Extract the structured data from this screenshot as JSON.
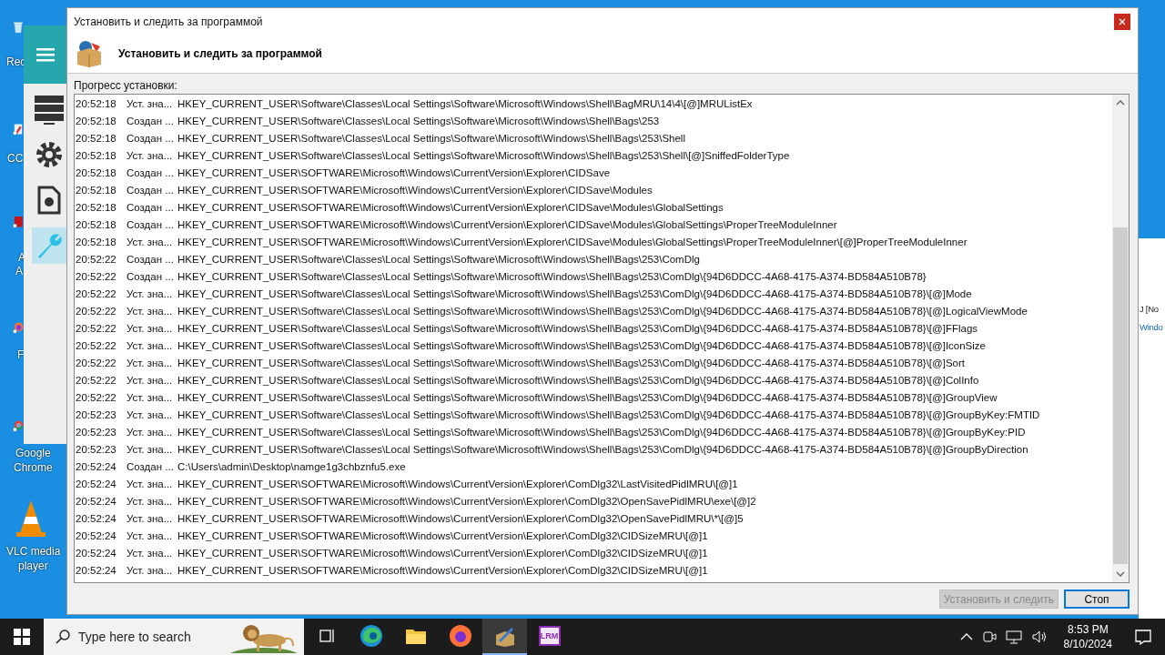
{
  "desktop": {
    "icons": [
      {
        "kind": "recycle",
        "lines": [
          "Rec"
        ]
      },
      {
        "kind": "cc",
        "lines": [
          "CC"
        ]
      },
      {
        "kind": "acrobat",
        "lines": [
          "A",
          "A"
        ]
      },
      {
        "kind": "firefox",
        "lines": [
          "F"
        ]
      },
      {
        "kind": "chrome",
        "lines": [
          "Google",
          "Chrome"
        ]
      },
      {
        "kind": "vlc",
        "lines": [
          "VLC media",
          "player"
        ]
      }
    ],
    "side_window": {
      "lines": [
        "J [No",
        "Windo"
      ]
    }
  },
  "background_app": {
    "sidebar": [
      {
        "kind": "server",
        "selected": false
      },
      {
        "kind": "gear",
        "selected": false
      },
      {
        "kind": "document",
        "selected": false
      },
      {
        "kind": "wrench",
        "selected": true
      }
    ]
  },
  "window": {
    "title": "Установить и следить за программой",
    "heading": "Установить и следить за программой",
    "progress_label": "Прогресс установки:",
    "log": [
      {
        "time": "20:52:18",
        "action": "Уст. зна...",
        "path": "HKEY_CURRENT_USER\\Software\\Classes\\Local Settings\\Software\\Microsoft\\Windows\\Shell\\BagMRU\\14\\4\\[@]MRUListEx"
      },
      {
        "time": "20:52:18",
        "action": "Создан ...",
        "path": "HKEY_CURRENT_USER\\Software\\Classes\\Local Settings\\Software\\Microsoft\\Windows\\Shell\\Bags\\253"
      },
      {
        "time": "20:52:18",
        "action": "Создан ...",
        "path": "HKEY_CURRENT_USER\\Software\\Classes\\Local Settings\\Software\\Microsoft\\Windows\\Shell\\Bags\\253\\Shell"
      },
      {
        "time": "20:52:18",
        "action": "Уст. зна...",
        "path": "HKEY_CURRENT_USER\\Software\\Classes\\Local Settings\\Software\\Microsoft\\Windows\\Shell\\Bags\\253\\Shell\\[@]SniffedFolderType"
      },
      {
        "time": "20:52:18",
        "action": "Создан ...",
        "path": "HKEY_CURRENT_USER\\SOFTWARE\\Microsoft\\Windows\\CurrentVersion\\Explorer\\CIDSave"
      },
      {
        "time": "20:52:18",
        "action": "Создан ...",
        "path": "HKEY_CURRENT_USER\\SOFTWARE\\Microsoft\\Windows\\CurrentVersion\\Explorer\\CIDSave\\Modules"
      },
      {
        "time": "20:52:18",
        "action": "Создан ...",
        "path": "HKEY_CURRENT_USER\\SOFTWARE\\Microsoft\\Windows\\CurrentVersion\\Explorer\\CIDSave\\Modules\\GlobalSettings"
      },
      {
        "time": "20:52:18",
        "action": "Создан ...",
        "path": "HKEY_CURRENT_USER\\SOFTWARE\\Microsoft\\Windows\\CurrentVersion\\Explorer\\CIDSave\\Modules\\GlobalSettings\\ProperTreeModuleInner"
      },
      {
        "time": "20:52:18",
        "action": "Уст. зна...",
        "path": "HKEY_CURRENT_USER\\SOFTWARE\\Microsoft\\Windows\\CurrentVersion\\Explorer\\CIDSave\\Modules\\GlobalSettings\\ProperTreeModuleInner\\[@]ProperTreeModuleInner"
      },
      {
        "time": "20:52:22",
        "action": "Создан ...",
        "path": "HKEY_CURRENT_USER\\Software\\Classes\\Local Settings\\Software\\Microsoft\\Windows\\Shell\\Bags\\253\\ComDlg"
      },
      {
        "time": "20:52:22",
        "action": "Создан ...",
        "path": "HKEY_CURRENT_USER\\Software\\Classes\\Local Settings\\Software\\Microsoft\\Windows\\Shell\\Bags\\253\\ComDlg\\{94D6DDCC-4A68-4175-A374-BD584A510B78}"
      },
      {
        "time": "20:52:22",
        "action": "Уст. зна...",
        "path": "HKEY_CURRENT_USER\\Software\\Classes\\Local Settings\\Software\\Microsoft\\Windows\\Shell\\Bags\\253\\ComDlg\\{94D6DDCC-4A68-4175-A374-BD584A510B78}\\[@]Mode"
      },
      {
        "time": "20:52:22",
        "action": "Уст. зна...",
        "path": "HKEY_CURRENT_USER\\Software\\Classes\\Local Settings\\Software\\Microsoft\\Windows\\Shell\\Bags\\253\\ComDlg\\{94D6DDCC-4A68-4175-A374-BD584A510B78}\\[@]LogicalViewMode"
      },
      {
        "time": "20:52:22",
        "action": "Уст. зна...",
        "path": "HKEY_CURRENT_USER\\Software\\Classes\\Local Settings\\Software\\Microsoft\\Windows\\Shell\\Bags\\253\\ComDlg\\{94D6DDCC-4A68-4175-A374-BD584A510B78}\\[@]FFlags"
      },
      {
        "time": "20:52:22",
        "action": "Уст. зна...",
        "path": "HKEY_CURRENT_USER\\Software\\Classes\\Local Settings\\Software\\Microsoft\\Windows\\Shell\\Bags\\253\\ComDlg\\{94D6DDCC-4A68-4175-A374-BD584A510B78}\\[@]IconSize"
      },
      {
        "time": "20:52:22",
        "action": "Уст. зна...",
        "path": "HKEY_CURRENT_USER\\Software\\Classes\\Local Settings\\Software\\Microsoft\\Windows\\Shell\\Bags\\253\\ComDlg\\{94D6DDCC-4A68-4175-A374-BD584A510B78}\\[@]Sort"
      },
      {
        "time": "20:52:22",
        "action": "Уст. зна...",
        "path": "HKEY_CURRENT_USER\\Software\\Classes\\Local Settings\\Software\\Microsoft\\Windows\\Shell\\Bags\\253\\ComDlg\\{94D6DDCC-4A68-4175-A374-BD584A510B78}\\[@]ColInfo"
      },
      {
        "time": "20:52:22",
        "action": "Уст. зна...",
        "path": "HKEY_CURRENT_USER\\Software\\Classes\\Local Settings\\Software\\Microsoft\\Windows\\Shell\\Bags\\253\\ComDlg\\{94D6DDCC-4A68-4175-A374-BD584A510B78}\\[@]GroupView"
      },
      {
        "time": "20:52:23",
        "action": "Уст. зна...",
        "path": "HKEY_CURRENT_USER\\Software\\Classes\\Local Settings\\Software\\Microsoft\\Windows\\Shell\\Bags\\253\\ComDlg\\{94D6DDCC-4A68-4175-A374-BD584A510B78}\\[@]GroupByKey:FMTID"
      },
      {
        "time": "20:52:23",
        "action": "Уст. зна...",
        "path": "HKEY_CURRENT_USER\\Software\\Classes\\Local Settings\\Software\\Microsoft\\Windows\\Shell\\Bags\\253\\ComDlg\\{94D6DDCC-4A68-4175-A374-BD584A510B78}\\[@]GroupByKey:PID"
      },
      {
        "time": "20:52:23",
        "action": "Уст. зна...",
        "path": "HKEY_CURRENT_USER\\Software\\Classes\\Local Settings\\Software\\Microsoft\\Windows\\Shell\\Bags\\253\\ComDlg\\{94D6DDCC-4A68-4175-A374-BD584A510B78}\\[@]GroupByDirection"
      },
      {
        "time": "20:52:24",
        "action": "Создан ...",
        "path": "C:\\Users\\admin\\Desktop\\namge1g3chbznfu5.exe"
      },
      {
        "time": "20:52:24",
        "action": "Уст. зна...",
        "path": "HKEY_CURRENT_USER\\SOFTWARE\\Microsoft\\Windows\\CurrentVersion\\Explorer\\ComDlg32\\LastVisitedPidlMRU\\[@]1"
      },
      {
        "time": "20:52:24",
        "action": "Уст. зна...",
        "path": "HKEY_CURRENT_USER\\SOFTWARE\\Microsoft\\Windows\\CurrentVersion\\Explorer\\ComDlg32\\OpenSavePidlMRU\\exe\\[@]2"
      },
      {
        "time": "20:52:24",
        "action": "Уст. зна...",
        "path": "HKEY_CURRENT_USER\\SOFTWARE\\Microsoft\\Windows\\CurrentVersion\\Explorer\\ComDlg32\\OpenSavePidlMRU\\*\\[@]5"
      },
      {
        "time": "20:52:24",
        "action": "Уст. зна...",
        "path": "HKEY_CURRENT_USER\\SOFTWARE\\Microsoft\\Windows\\CurrentVersion\\Explorer\\ComDlg32\\CIDSizeMRU\\[@]1"
      },
      {
        "time": "20:52:24",
        "action": "Уст. зна...",
        "path": "HKEY_CURRENT_USER\\SOFTWARE\\Microsoft\\Windows\\CurrentVersion\\Explorer\\ComDlg32\\CIDSizeMRU\\[@]1"
      },
      {
        "time": "20:52:24",
        "action": "Уст. зна...",
        "path": "HKEY_CURRENT_USER\\SOFTWARE\\Microsoft\\Windows\\CurrentVersion\\Explorer\\ComDlg32\\CIDSizeMRU\\[@]1"
      }
    ],
    "buttons": [
      {
        "label": "Установить и следить",
        "disabled": true,
        "focused": false
      },
      {
        "label": "Стоп",
        "disabled": false,
        "focused": true
      }
    ]
  },
  "taskbar": {
    "search": {
      "placeholder": "Type here to search"
    },
    "apps": [
      {
        "kind": "taskview",
        "selected": false
      },
      {
        "kind": "edge",
        "selected": false
      },
      {
        "kind": "folder",
        "selected": false
      },
      {
        "kind": "firefox",
        "selected": false
      },
      {
        "kind": "installer",
        "selected": true
      },
      {
        "kind": "lrm",
        "selected": false,
        "label": "LRM"
      }
    ],
    "clock": {
      "time": "8:53 PM",
      "date": "8/10/2024"
    }
  }
}
